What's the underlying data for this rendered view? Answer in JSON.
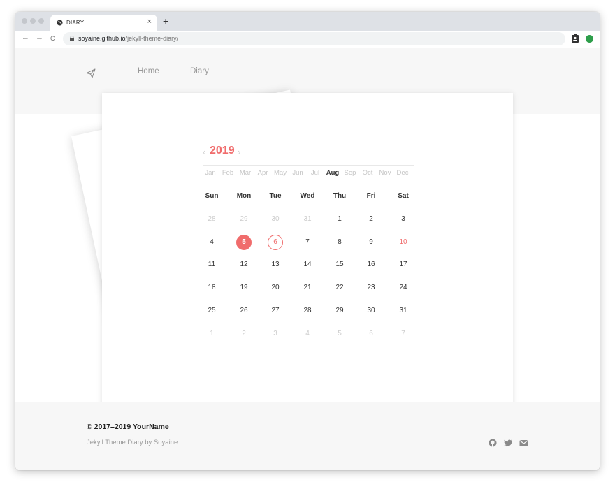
{
  "browser": {
    "tab_title": "DIARY",
    "tab_close": "×",
    "new_tab": "+",
    "url_host": "soyaine.github.io",
    "url_path": "/jekyll-theme-diary/",
    "back": "←",
    "forward": "→",
    "reload": "C"
  },
  "nav": {
    "logo_icon": "paper-plane-icon",
    "links": [
      "Home",
      "Diary"
    ]
  },
  "calendar": {
    "year": "2019",
    "prev": "‹",
    "next": "›",
    "months": [
      "Jan",
      "Feb",
      "Mar",
      "Apr",
      "May",
      "Jun",
      "Jul",
      "Aug",
      "Sep",
      "Oct",
      "Nov",
      "Dec"
    ],
    "active_month": "Aug",
    "weekdays": [
      "Sun",
      "Mon",
      "Tue",
      "Wed",
      "Thu",
      "Fri",
      "Sat"
    ],
    "weeks": [
      [
        "28",
        "29",
        "30",
        "31",
        "1",
        "2",
        "3"
      ],
      [
        "4",
        "5",
        "6",
        "7",
        "8",
        "9",
        "10"
      ],
      [
        "11",
        "12",
        "13",
        "14",
        "15",
        "16",
        "17"
      ],
      [
        "18",
        "19",
        "20",
        "21",
        "22",
        "23",
        "24"
      ],
      [
        "25",
        "26",
        "27",
        "28",
        "29",
        "30",
        "31"
      ],
      [
        "1",
        "2",
        "3",
        "4",
        "5",
        "6",
        "7"
      ]
    ],
    "highlight_color": "#f06c6c"
  },
  "footer": {
    "copyright": "© 2017–2019 YourName",
    "credit": "Jekyll Theme Diary by Soyaine",
    "social_icons": [
      "github-icon",
      "twitter-icon",
      "email-icon"
    ]
  }
}
